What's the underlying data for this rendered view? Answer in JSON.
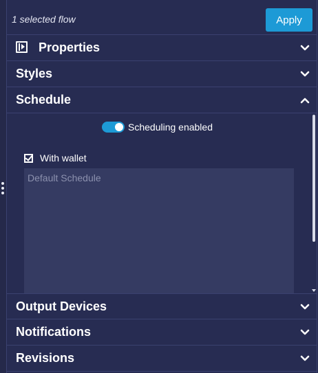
{
  "header": {
    "selected_text": "1 selected flow",
    "apply_label": "Apply"
  },
  "sections": {
    "properties": {
      "title": "Properties",
      "icon": "panel-play-icon",
      "expanded": false
    },
    "styles": {
      "title": "Styles",
      "expanded": false
    },
    "schedule": {
      "title": "Schedule",
      "expanded": true
    },
    "output_devices": {
      "title": "Output Devices",
      "expanded": false
    },
    "notifications": {
      "title": "Notifications",
      "expanded": false
    },
    "revisions": {
      "title": "Revisions",
      "expanded": false
    }
  },
  "schedule": {
    "toggle_label": "Scheduling enabled",
    "toggle_on": true,
    "checkbox_label": "With wallet",
    "checkbox_checked": true,
    "textarea_placeholder": "Default Schedule",
    "textarea_value": ""
  },
  "colors": {
    "accent": "#1d9ad6",
    "panel_bg": "#272c52",
    "divider": "#3b4170",
    "textarea_bg": "#353b62"
  }
}
